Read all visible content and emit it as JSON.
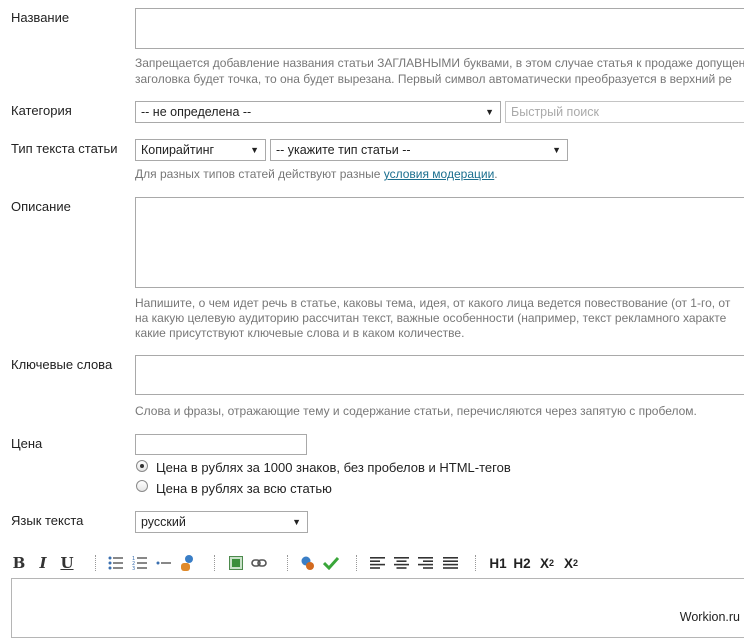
{
  "fields": {
    "title": {
      "label": "Название",
      "value": "",
      "hint_line1": "Запрещается добавление названия статьи ЗАГЛАВНЫМИ буквами, в этом случае статья к продаже допущен",
      "hint_line2": "заголовка будет точка, то она будет вырезана. Первый символ автоматически преобразуется в верхний ре"
    },
    "category": {
      "label": "Категория",
      "selected": "-- не определена --",
      "quick_search_placeholder": "Быстрый поиск"
    },
    "text_type": {
      "label": "Тип текста статьи",
      "selected_type": "Копирайтинг",
      "selected_subtype": "-- укажите тип статьи --",
      "hint_prefix": "Для разных типов статей действуют разные ",
      "hint_link": "условия модерации",
      "hint_suffix": "."
    },
    "description": {
      "label": "Описание",
      "value": "",
      "hint_line1": "Напишите, о чем идет речь в статье, каковы тема, идея, от какого лица ведется повествование (от 1-го, от",
      "hint_line2": "на какую целевую аудиторию рассчитан текст, важные особенности (например, текст рекламного характе",
      "hint_line3": "какие присутствуют ключевые слова и в каком количестве."
    },
    "keywords": {
      "label": "Ключевые слова",
      "value": "",
      "hint": "Слова и фразы, отражающие тему и содержание статьи, перечисляются через запятую с пробелом."
    },
    "price": {
      "label": "Цена",
      "value": "",
      "option1": "Цена в рублях за 1000 знаков, без пробелов и HTML-тегов",
      "option2": "Цена в рублях за всю статью",
      "option1_checked": true
    },
    "language": {
      "label": "Язык текста",
      "selected": "русский"
    }
  },
  "toolbar": {
    "bold": "B",
    "italic": "I",
    "underline": "U",
    "h1": "H1",
    "h2": "H2",
    "sup": "X",
    "sup_index": "2",
    "sub": "X",
    "sub_index": "2",
    "icons": [
      "bullet-list-icon",
      "numbered-list-icon",
      "horizontal-rule-icon",
      "user-quote-icon",
      "image-icon",
      "link-icon",
      "eraser-icon",
      "checkmark-icon",
      "align-left-icon",
      "align-center-icon",
      "align-right-icon",
      "align-justify-icon"
    ],
    "accent_colors": {
      "check": "#3aa63a",
      "image": "#3a8f3a",
      "eraser": "#d26a1f",
      "link": "#1a6e8e"
    }
  },
  "watermark": "Workion.ru"
}
